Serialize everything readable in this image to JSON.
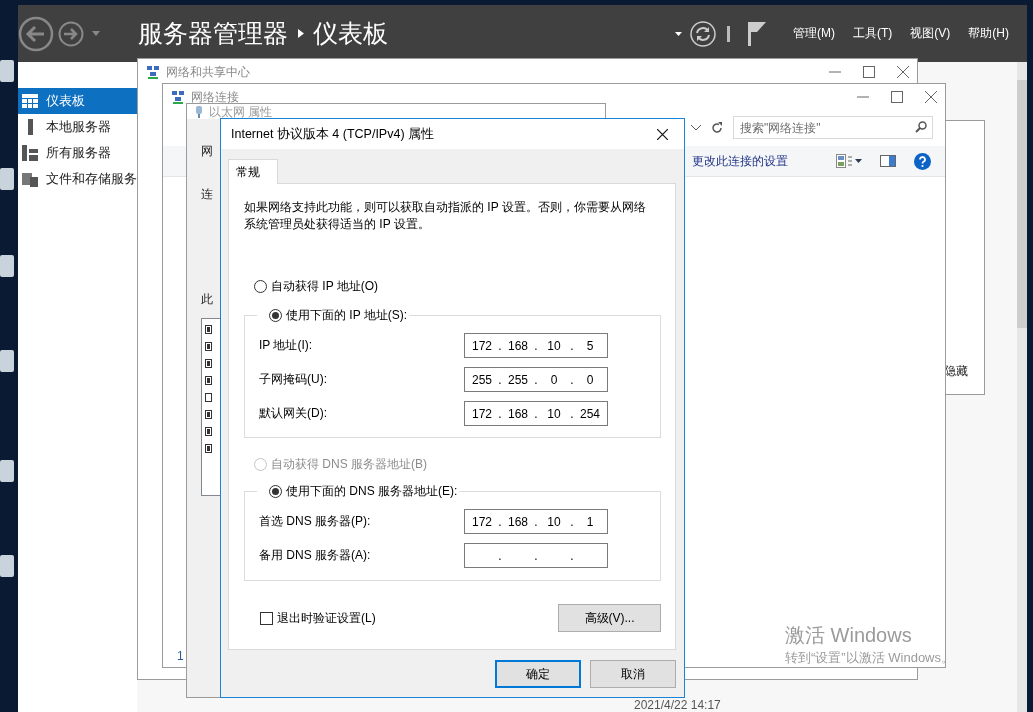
{
  "server_manager": {
    "breadcrumb": [
      "服务器管理器",
      "仪表板"
    ],
    "menu": [
      "管理(M)",
      "工具(T)",
      "视图(V)",
      "帮助(H)"
    ],
    "sidebar": [
      {
        "label": "仪表板",
        "selected": true
      },
      {
        "label": "本地服务器",
        "selected": false
      },
      {
        "label": "所有服务器",
        "selected": false
      },
      {
        "label": "文件和存储服务",
        "selected": false
      }
    ],
    "panel_text": "隐藏",
    "timestamp": "2021/4/22 14:17"
  },
  "sharing_center": {
    "title": "网络和共享中心"
  },
  "connections": {
    "title": "网络连接",
    "search": {
      "placeholder": "搜索\"网络连接\""
    },
    "command": "更改此连接的设置",
    "footer": "1"
  },
  "ethernet": {
    "title": "以太网 属性",
    "tab": "网",
    "labels": [
      "连",
      "此"
    ],
    "items": [
      {
        "checked": true
      },
      {
        "checked": true
      },
      {
        "checked": true
      },
      {
        "checked": true
      },
      {
        "checked": false
      },
      {
        "checked": true
      },
      {
        "checked": true
      },
      {
        "checked": true
      }
    ]
  },
  "dialog": {
    "title": "Internet 协议版本 4 (TCP/IPv4) 属性",
    "tabs": [
      {
        "label": "常规",
        "selected": true
      }
    ],
    "description": "如果网络支持此功能，则可以获取自动指派的 IP 设置。否则，你需要从网络系统管理员处获得适当的 IP 设置。",
    "separator": ".",
    "ip_auto": {
      "label": "自动获得 IP 地址(O)",
      "selected": false,
      "disabled": false
    },
    "ip_manual": {
      "label": "使用下面的 IP 地址(S):",
      "selected": true,
      "disabled": false
    },
    "ip_fields": [
      {
        "label": "IP 地址(I):",
        "octets": [
          "172",
          "168",
          "10",
          "5"
        ]
      },
      {
        "label": "子网掩码(U):",
        "octets": [
          "255",
          "255",
          "0",
          "0"
        ]
      },
      {
        "label": "默认网关(D):",
        "octets": [
          "172",
          "168",
          "10",
          "254"
        ]
      }
    ],
    "dns_auto": {
      "label": "自动获得 DNS 服务器地址(B)",
      "selected": false,
      "disabled": true
    },
    "dns_manual": {
      "label": "使用下面的 DNS 服务器地址(E):",
      "selected": true,
      "disabled": false
    },
    "dns_fields": [
      {
        "label": "首选 DNS 服务器(P):",
        "octets": [
          "172",
          "168",
          "10",
          "1"
        ]
      },
      {
        "label": "备用 DNS 服务器(A):"
      }
    ],
    "validate": {
      "label": "退出时验证设置(L)",
      "checked": false
    },
    "advanced": "高级(V)...",
    "buttons": [
      {
        "label": "确定",
        "default": true
      },
      {
        "label": "取消",
        "default": false
      }
    ]
  },
  "activation": {
    "title": "激活 Windows",
    "subtitle": "转到“设置”以激活 Windows。"
  }
}
